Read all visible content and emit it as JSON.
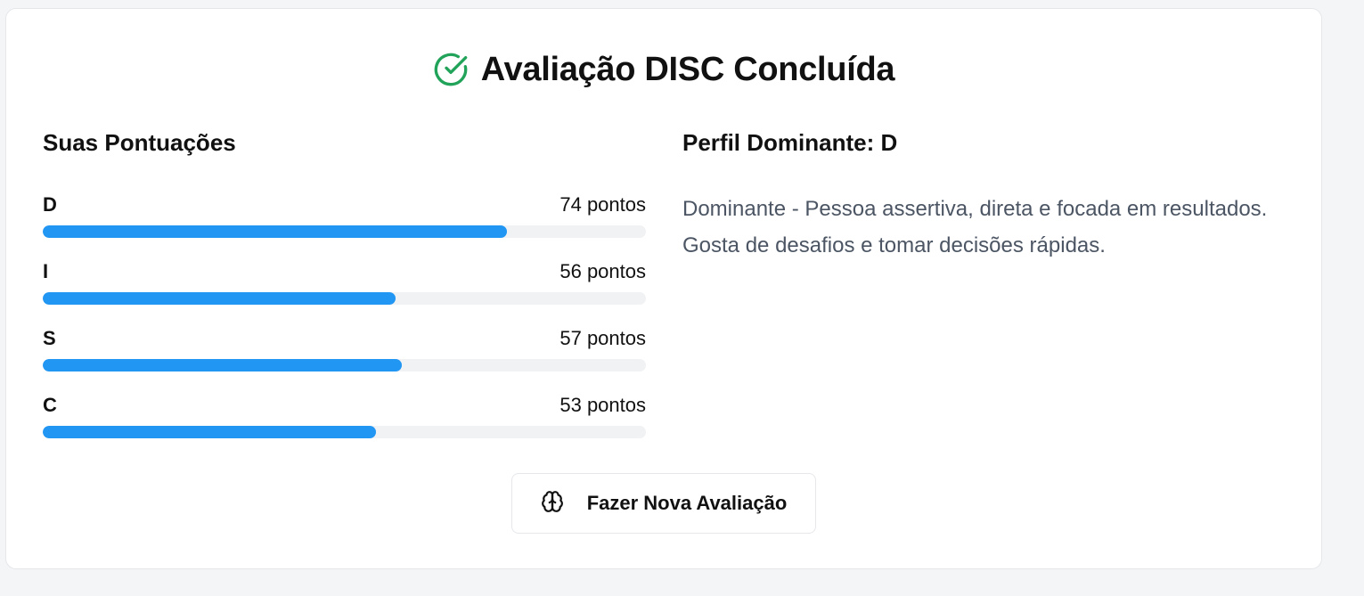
{
  "header": {
    "title": "Avaliação DISC Concluída",
    "icon": "check-circle-icon",
    "icon_color": "#22a35a"
  },
  "scores": {
    "title": "Suas Pontuações",
    "bar_color": "#2196f3",
    "items": [
      {
        "letter": "D",
        "points_label": "74 pontos",
        "fill_percent": 77
      },
      {
        "letter": "I",
        "points_label": "56 pontos",
        "fill_percent": 58.5
      },
      {
        "letter": "S",
        "points_label": "57 pontos",
        "fill_percent": 59.5
      },
      {
        "letter": "C",
        "points_label": "53 pontos",
        "fill_percent": 55.3
      }
    ]
  },
  "profile": {
    "title": "Perfil Dominante: D",
    "description": "Dominante - Pessoa assertiva, direta e focada em resultados. Gosta de desafios e tomar decisões rápidas."
  },
  "action": {
    "label": "Fazer Nova Avaliação",
    "icon": "brain-icon"
  }
}
